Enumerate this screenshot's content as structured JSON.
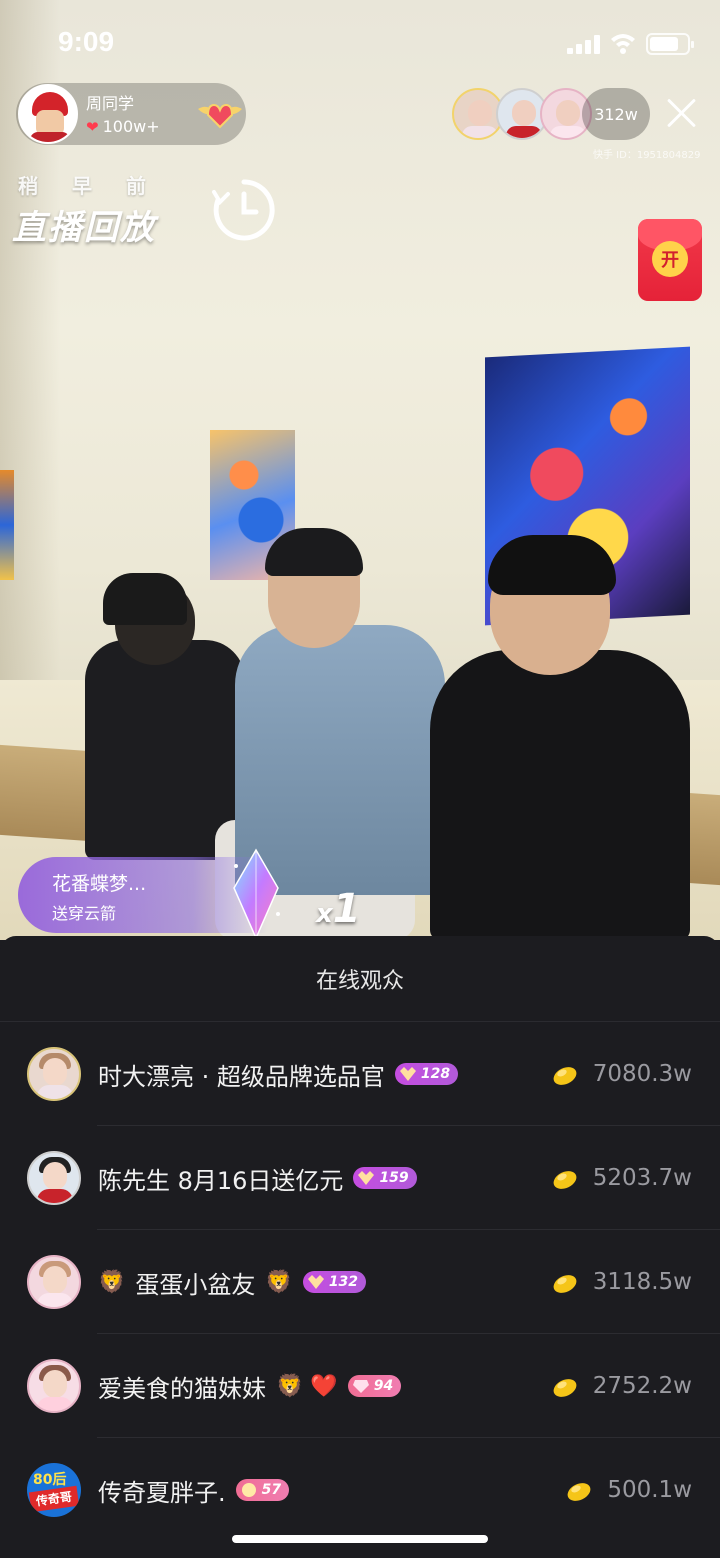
{
  "status_bar": {
    "time": "9:09"
  },
  "host": {
    "name": "周同学",
    "likes": "100w+"
  },
  "replay": {
    "small": "稍早前",
    "big": "直播回放"
  },
  "viewers": {
    "count": "312w",
    "kwai_id": "快手 ID：1951804829"
  },
  "red_packet": {
    "label": "开"
  },
  "gift": {
    "sender": "花番蝶梦...",
    "action": "送穿云箭",
    "count": "1",
    "count_prefix": "x"
  },
  "audience": {
    "title": "在线观众",
    "rows": [
      {
        "name": "时大漂亮 · 超级品牌选品官",
        "prefix_emoji": "",
        "suffix_emoji": "",
        "level": "128",
        "coins": "7080.3w",
        "avatar": "woman-avatar"
      },
      {
        "name": "陈先生 8月16日送亿元",
        "prefix_emoji": "",
        "suffix_emoji": "",
        "level": "159",
        "coins": "5203.7w",
        "avatar": "man-avatar"
      },
      {
        "name": "蛋蛋小盆友",
        "prefix_emoji": "🦁",
        "suffix_emoji": "🦁",
        "level": "132",
        "coins": "3118.5w",
        "avatar": "girl-avatar"
      },
      {
        "name": "爱美食的猫妹妹",
        "prefix_emoji": "",
        "suffix_emoji": "🦁 ❤️",
        "level": "94",
        "coins": "2752.2w",
        "avatar": "girl-avatar"
      },
      {
        "name": "传奇夏胖子.",
        "prefix_emoji": "",
        "suffix_emoji": "",
        "level": "57",
        "coins": "500.1w",
        "avatar": "logo-80-avatar"
      }
    ],
    "logo_text": {
      "top": "80后",
      "bottom": "传奇哥"
    }
  },
  "colors": {
    "sheet_bg": "#1c1c20",
    "level_badge": "#c54de0",
    "coin": "#f5c518",
    "heart": "#ff3b4e",
    "red_packet": "#e52238"
  }
}
